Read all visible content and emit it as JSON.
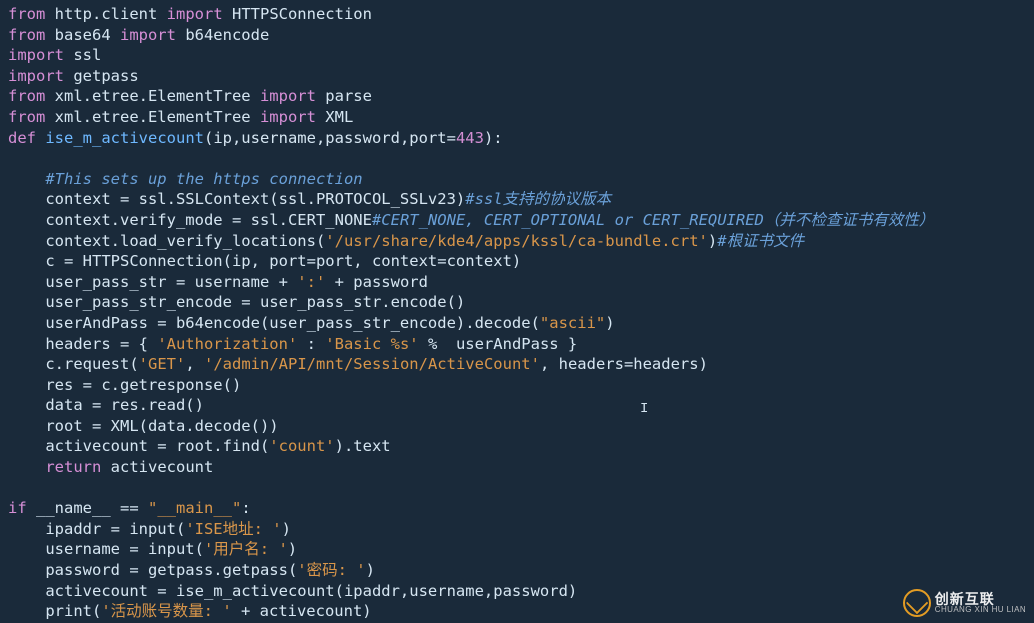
{
  "code": {
    "lines": [
      {
        "t": [
          [
            "kw",
            "from"
          ],
          [
            "id",
            " http.client "
          ],
          [
            "kw",
            "import"
          ],
          [
            "id",
            " HTTPSConnection"
          ]
        ]
      },
      {
        "t": [
          [
            "kw",
            "from"
          ],
          [
            "id",
            " base64 "
          ],
          [
            "kw",
            "import"
          ],
          [
            "id",
            " b64encode"
          ]
        ]
      },
      {
        "t": [
          [
            "kw",
            "import"
          ],
          [
            "id",
            " ssl"
          ]
        ]
      },
      {
        "t": [
          [
            "kw",
            "import"
          ],
          [
            "id",
            " getpass"
          ]
        ]
      },
      {
        "t": [
          [
            "kw",
            "from"
          ],
          [
            "id",
            " xml.etree.ElementTree "
          ],
          [
            "kw",
            "import"
          ],
          [
            "id",
            " parse"
          ]
        ]
      },
      {
        "t": [
          [
            "kw",
            "from"
          ],
          [
            "id",
            " xml.etree.ElementTree "
          ],
          [
            "kw",
            "import"
          ],
          [
            "id",
            " XML"
          ]
        ]
      },
      {
        "t": [
          [
            "kw",
            "def"
          ],
          [
            "id",
            " "
          ],
          [
            "fn",
            "ise_m_activecount"
          ],
          [
            "punc",
            "(ip,username,password,port="
          ],
          [
            "num",
            "443"
          ],
          [
            "punc",
            "):"
          ]
        ]
      },
      {
        "t": [
          [
            "id",
            ""
          ]
        ]
      },
      {
        "t": [
          [
            "id",
            "    "
          ],
          [
            "cmt",
            "#This sets up the https connection"
          ]
        ]
      },
      {
        "t": [
          [
            "id",
            "    context = ssl.SSLContext(ssl.PROTOCOL_SSLv23)"
          ],
          [
            "cmt",
            "#ssl支持的协议版本"
          ]
        ]
      },
      {
        "t": [
          [
            "id",
            "    context.verify_mode = ssl.CERT_NONE"
          ],
          [
            "cmt",
            "#CERT_NONE, CERT_OPTIONAL or CERT_REQUIRED（并不检查证书有效性）"
          ]
        ]
      },
      {
        "t": [
          [
            "id",
            "    context.load_verify_locations("
          ],
          [
            "str",
            "'/usr/share/kde4/apps/kssl/ca-bundle.crt'"
          ],
          [
            "punc",
            ")"
          ],
          [
            "cmt",
            "#根证书文件"
          ]
        ]
      },
      {
        "t": [
          [
            "id",
            "    c = HTTPSConnection(ip, port=port, context=context)"
          ]
        ]
      },
      {
        "t": [
          [
            "id",
            "    user_pass_str = username + "
          ],
          [
            "str",
            "':'"
          ],
          [
            "id",
            " + password"
          ]
        ]
      },
      {
        "t": [
          [
            "id",
            "    user_pass_str_encode = user_pass_str.encode()"
          ]
        ]
      },
      {
        "t": [
          [
            "id",
            "    userAndPass = b64encode(user_pass_str_encode).decode("
          ],
          [
            "str",
            "\"ascii\""
          ],
          [
            "punc",
            ")"
          ]
        ]
      },
      {
        "t": [
          [
            "id",
            "    headers = { "
          ],
          [
            "str",
            "'Authorization'"
          ],
          [
            "id",
            " : "
          ],
          [
            "str",
            "'Basic %s'"
          ],
          [
            "id",
            " %  userAndPass }"
          ]
        ]
      },
      {
        "t": [
          [
            "id",
            "    c.request("
          ],
          [
            "str",
            "'GET'"
          ],
          [
            "punc",
            ", "
          ],
          [
            "str",
            "'/admin/API/mnt/Session/ActiveCount'"
          ],
          [
            "punc",
            ", headers=headers)"
          ]
        ]
      },
      {
        "t": [
          [
            "id",
            "    res = c.getresponse()"
          ]
        ]
      },
      {
        "t": [
          [
            "id",
            "    data = res.read()"
          ]
        ]
      },
      {
        "t": [
          [
            "id",
            "    root = XML(data.decode())"
          ]
        ]
      },
      {
        "t": [
          [
            "id",
            "    activecount = root.find("
          ],
          [
            "str",
            "'count'"
          ],
          [
            "punc",
            ").text"
          ]
        ]
      },
      {
        "t": [
          [
            "id",
            "    "
          ],
          [
            "kw",
            "return"
          ],
          [
            "id",
            " activecount"
          ]
        ]
      },
      {
        "t": [
          [
            "id",
            ""
          ]
        ]
      },
      {
        "t": [
          [
            "kw",
            "if"
          ],
          [
            "id",
            " __name__ == "
          ],
          [
            "str",
            "\"__main__\""
          ],
          [
            "punc",
            ":"
          ]
        ]
      },
      {
        "t": [
          [
            "id",
            "    ipaddr = input("
          ],
          [
            "str",
            "'ISE地址: '"
          ],
          [
            "punc",
            ")"
          ]
        ]
      },
      {
        "t": [
          [
            "id",
            "    username = input("
          ],
          [
            "str",
            "'用户名: '"
          ],
          [
            "punc",
            ")"
          ]
        ]
      },
      {
        "t": [
          [
            "id",
            "    password = getpass.getpass("
          ],
          [
            "str",
            "'密码: '"
          ],
          [
            "punc",
            ")"
          ]
        ]
      },
      {
        "t": [
          [
            "id",
            "    activecount = ise_m_activecount(ipaddr,username,password)"
          ]
        ]
      },
      {
        "t": [
          [
            "id",
            "    print("
          ],
          [
            "str",
            "'活动账号数量: '"
          ],
          [
            "id",
            " + activecount)"
          ]
        ]
      }
    ]
  },
  "watermark": {
    "cn": "创新互联",
    "en": "CHUANG XIN HU LIAN"
  }
}
